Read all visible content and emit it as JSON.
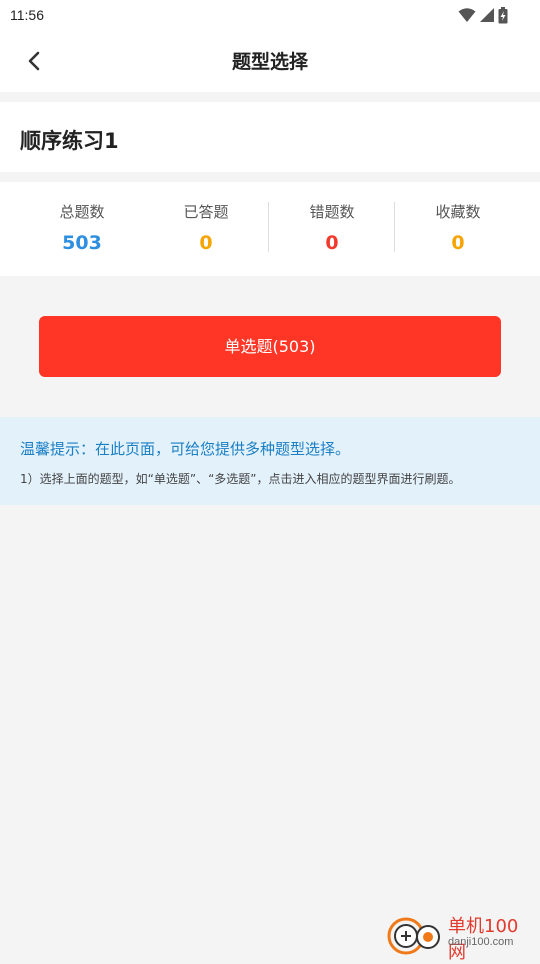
{
  "status_bar": {
    "time": "11:56",
    "icons": [
      "wifi-icon",
      "signal-icon",
      "battery-icon"
    ]
  },
  "nav": {
    "title": "题型选择",
    "back_icon": "chevron-left-icon"
  },
  "practice": {
    "title": "顺序练习1"
  },
  "stats": [
    {
      "label": "总题数",
      "value": "503",
      "color": "#2e8fe0"
    },
    {
      "label": "已答题",
      "value": "0",
      "color": "#f6a500"
    },
    {
      "label": "错题数",
      "value": "0",
      "color": "#f23a2c"
    },
    {
      "label": "收藏数",
      "value": "0",
      "color": "#f6a500"
    }
  ],
  "question_types": [
    {
      "label": "单选题(503)",
      "color": "#ff3526"
    }
  ],
  "tip": {
    "title": "温馨提示：在此页面，可给您提供多种题型选择。",
    "lines": [
      "1）选择上面的题型，如“单选题”、“多选题”，点击进入相应的题型界面进行刷题。"
    ]
  },
  "watermark": {
    "text_cn": "单机100网",
    "text_en": "danji100.com"
  }
}
